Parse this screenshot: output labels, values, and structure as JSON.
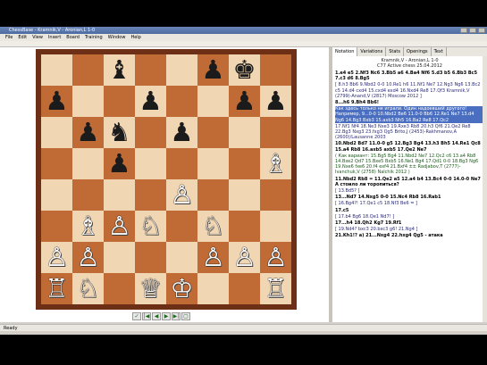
{
  "window": {
    "title": "ChessBase - Kramnik,V - Aronian,L 1-0"
  },
  "menu": {
    "items": [
      "File",
      "Edit",
      "View",
      "Insert",
      "Board",
      "Training",
      "Window",
      "Help"
    ]
  },
  "board": {
    "rows": [
      [
        "",
        "♜",
        "",
        "♝",
        "♛",
        "",
        "♜",
        ""
      ],
      [
        "",
        "",
        "♝",
        "",
        "",
        "♟",
        "♚",
        ""
      ],
      [
        "♟",
        "",
        "",
        "♟",
        "",
        "",
        "♟",
        "♟"
      ],
      [
        "",
        "♟",
        "♞",
        "",
        "♟",
        "",
        "",
        ""
      ],
      [
        "",
        "",
        "♟",
        "",
        "",
        "",
        "",
        "♗"
      ],
      [
        "",
        "",
        "",
        "",
        "♙",
        "",
        "",
        ""
      ],
      [
        "",
        "♗",
        "♙",
        "♘",
        "",
        "♘",
        "",
        ""
      ],
      [
        "♙",
        "♙",
        "",
        "",
        "",
        "♙",
        "♙",
        "♙"
      ],
      [
        "♖",
        "♘",
        "",
        "♕",
        "♔",
        "",
        "",
        "♖"
      ]
    ],
    "colors": {
      "light_square": "#f1d6b3",
      "dark_square": "#c06b36",
      "frame": "#6e2f17"
    }
  },
  "nav_buttons": [
    "✓",
    "|◀",
    "◀",
    "▶",
    "▶|",
    "▢"
  ],
  "tabs": [
    "Notation",
    "Variations",
    "Stats",
    "Openings",
    "Text"
  ],
  "game": {
    "header_line1": "Kramnik,V - Aronian,L  1-0",
    "header_line2": "C77 Active chess 25.04.2012"
  },
  "notation": [
    {
      "cls": "main",
      "text": "1.e4 e5 2.Nf3 Nc6 3.Bb5 a6 4.Ba4 Nf6 5.d3 b5 6.Bb3 Bc5 7.c3 d6 8.Bg5"
    },
    {
      "cls": "var",
      "text": "[ 8.h3 Bb6 9.Nbd2 0-0 10.Re1 h6 11.Nf1 Ne7 12.Ng3 Ng6 13.Bc2 c5 14.d4 cxd4 15.cxd4 exd4 16.Nxd4 Re8 17.Qf3 Kramnik,V (2799)-Anand,V (2817) Moscow 2012 ]"
    },
    {
      "cls": "main",
      "text": "8...h6 9.Bh4 Bb6!"
    },
    {
      "cls": "hl",
      "text": "Как здесь только не играли. Один надоевший другого! Например, 9...0-0 10.Nbd2 Be6 11.0-0 Bb6 12.Re1 Ne7 13.d4 Ng6 14.Bg3 Bxb3 15.axb3 Nh5 16.Ba2 Re8 17.Qc2"
    },
    {
      "cls": "var",
      "text": "17.Nf1 Nf4 18.Ne3 Nxe3 19.Rxe3 Rb8 20.h3 Qf6 21.Qe2 Re8 22.Bg3 Nxg3 23.fxg3 Qg5 Brito,J (2453)-Rakhmanov,A (2600)/Lausanne 2003"
    },
    {
      "cls": "main",
      "text": "10.Nbd2 Bd7 11.0-0 g5 12.Bg3 Bg4 13.h3 Bh5 14.Re1 Qc8 15.a4 Rb8 16.axb5 axb5 17.Qe2 Ne7"
    },
    {
      "cls": "cmt",
      "text": "( Как вариант: 15.Bg5 Bg4 11.Nbd2 Ne7 12.Qc2 c6 13.a4 Rb8 14.Bxe2 Qd7 15.Bxe5 Bxb5 16.Ne1 Bg4 17.Qd1 0-0 18.Bg3 Ng6 19.Nxe6 fxe6 20.f4 exf4 21.Bxf4 ±± Radjabov,T (2777)-Ivanchuk,V (2758) Nalchik 2012 )"
    },
    {
      "cls": "main",
      "text": "11.Nbd2 Rb8 = 11.Qe2 a5 12.a4 b4 13.Bc4 0-0 14.0-0 Ne7 А стоило ли торопиться?"
    },
    {
      "cls": "var",
      "text": "[ 13.Bd5? ]"
    },
    {
      "cls": "main",
      "text": "13...Nd7 14.Nxg5 0-0 15.Nc4 Rb8 16.Rab1"
    },
    {
      "cls": "var",
      "text": "[ 16.Bg4?! 17.Qe1 c5 18.Nf3 Be6 = ]"
    },
    {
      "cls": "main",
      "text": "17.c5"
    },
    {
      "cls": "var",
      "text": "[ 17.b4 Bg6 18.Qe1 Nd7! ]"
    },
    {
      "cls": "main",
      "text": "17...h4 18.Qh2 Kg7 19.Rf1"
    },
    {
      "cls": "var",
      "text": "[ 19.Nd4? bxc3 20.bxc3 g6! 21.Ng4 ]"
    },
    {
      "cls": "main",
      "text": "21.Kh1!? a) 21...Nxg4 22.hxg4 Qg5 - атака"
    }
  ],
  "status": {
    "text": "Ready"
  }
}
